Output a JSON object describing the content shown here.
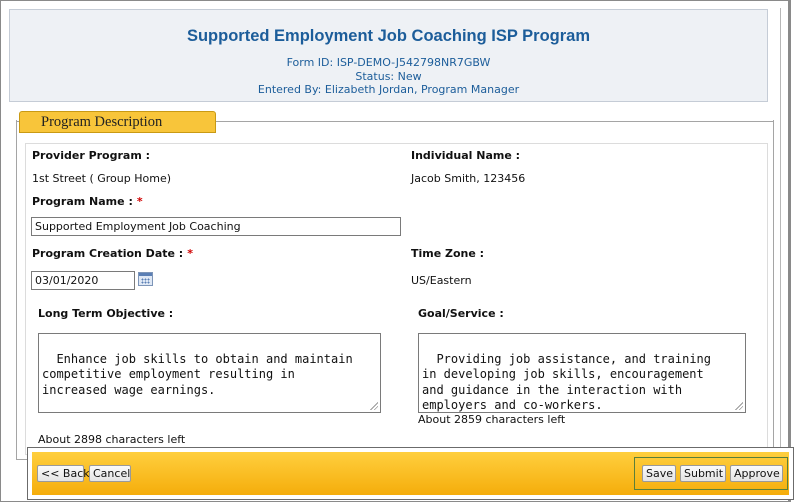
{
  "header": {
    "title": "Supported Employment Job Coaching ISP Program",
    "form_id": "Form ID: ISP-DEMO-J542798NR7GBW",
    "status": "Status: New",
    "entered_by": "Entered By: Elizabeth Jordan, Program Manager"
  },
  "section": {
    "legend": "Program Description",
    "provider_program_label": "Provider Program :",
    "provider_program_value": "1st Street ( Group Home)",
    "individual_name_label": "Individual Name :",
    "individual_name_value": "Jacob Smith, 123456",
    "program_name_label": "Program Name :",
    "program_name_value": "Supported Employment Job Coaching",
    "creation_date_label": "Program Creation Date :",
    "creation_date_value": "03/01/2020",
    "time_zone_label": "Time Zone :",
    "time_zone_value": "US/Eastern",
    "required_mark": "*",
    "long_term_objective_label": "Long Term Objective :",
    "long_term_objective_value": "Enhance job skills to obtain and maintain\ncompetitive employment resulting in\nincreased wage earnings.",
    "long_term_objective_counter": "About 2898 characters left",
    "goal_service_label": "Goal/Service :",
    "goal_service_value": "Providing job assistance, and training\nin developing job skills, encouragement\nand guidance in the interaction with\nemployers and co-workers.",
    "goal_service_counter": "About 2859 characters left"
  },
  "actions": {
    "back": "<< Back",
    "cancel": "Cancel",
    "save": "Save",
    "submit": "Submit",
    "approve": "Approve"
  },
  "colors": {
    "title_blue": "#1c5d9a",
    "legend_gold": "#f8c53a",
    "action_bar": "#ffc021",
    "required_red": "#d00000"
  }
}
